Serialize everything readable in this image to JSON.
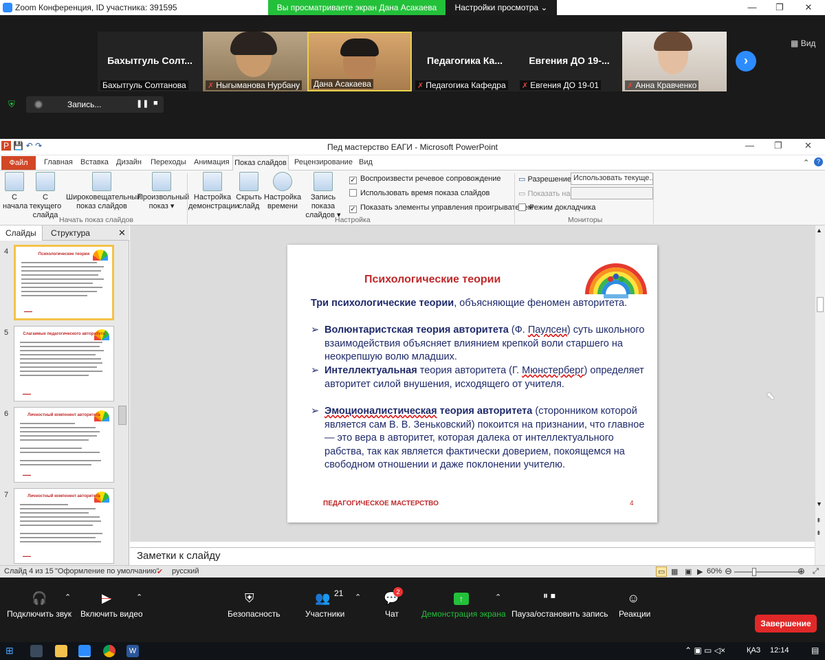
{
  "zoom": {
    "window_title": "Zoom Конференция, ID участника: 391595",
    "view_banner": "Вы просматриваете экран Дана Асакаева",
    "view_options": "Настройки просмотра",
    "view_label": "Вид",
    "recording_label": "Запись...",
    "participants": [
      {
        "big": "Бахытгуль Солт...",
        "name": "Бахытгуль Солтанова",
        "muted": false
      },
      {
        "big": "",
        "name": "Ныгыманова Нурбану",
        "muted": true
      },
      {
        "big": "",
        "name": "Дана Асакаева",
        "muted": false
      },
      {
        "big": "Педагогика Ка...",
        "name": "Педагогика Кафедра",
        "muted": true
      },
      {
        "big": "Евгения ДО 19-...",
        "name": "Евгения ДО 19-01",
        "muted": true
      },
      {
        "big": "",
        "name": "Анна Кравченко",
        "muted": true
      }
    ],
    "toolbar": {
      "audio": "Подключить звук",
      "video": "Включить видео",
      "security": "Безопасность",
      "participants": "Участники",
      "participants_count": "21",
      "chat": "Чат",
      "chat_badge": "2",
      "share": "Демонстрация экрана",
      "record": "Пауза/остановить запись",
      "reactions": "Реакции",
      "end": "Завершение"
    }
  },
  "ppt": {
    "title": "Пед мастерство ЕАГИ  -  Microsoft PowerPoint",
    "tabs": [
      "Файл",
      "Главная",
      "Вставка",
      "Дизайн",
      "Переходы",
      "Анимация",
      "Показ слайдов",
      "Рецензирование",
      "Вид"
    ],
    "ribbon": {
      "group1_label": "Начать показ слайдов",
      "btn_from_start": [
        "С",
        "начала"
      ],
      "btn_from_current": [
        "С текущего",
        "слайда"
      ],
      "btn_broadcast": [
        "Широковещательный",
        "показ слайдов"
      ],
      "btn_custom": [
        "Произвольный",
        "показ"
      ],
      "group2_label": "Настройка",
      "btn_setup": [
        "Настройка",
        "демонстрации"
      ],
      "btn_hide": [
        "Скрыть",
        "слайд"
      ],
      "btn_rehearse": [
        "Настройка",
        "времени"
      ],
      "btn_record": [
        "Запись показа",
        "слайдов"
      ],
      "chk_narration": "Воспроизвести речевое сопровождение",
      "chk_timings": "Использовать время показа слайдов",
      "chk_controls": "Показать элементы управления проигрывателем",
      "group3_label": "Мониторы",
      "resolution_label": "Разрешение:",
      "resolution_value": "Использовать текуще...",
      "show_on_label": "Показать на:",
      "presenter_view": "Режим докладчика"
    },
    "pane_tabs": [
      "Слайды",
      "Структура"
    ],
    "thumbs": [
      {
        "num": "4",
        "title": "Психологические теории"
      },
      {
        "num": "5",
        "title": "Слагаемые педагогического авторитета"
      },
      {
        "num": "6",
        "title": "Личностный компонент авторитета"
      },
      {
        "num": "7",
        "title": "Личностный компонент авторитета"
      }
    ],
    "slide": {
      "title": "Психологические теории",
      "intro_bold": "Три психологические теории",
      "intro_rest": ", объясняющие феномен авторитета.",
      "b1_bold": "Волюнтаристская теория авторитета",
      "b1_a": " (Ф. ",
      "b1_u": "Паулсен",
      "b1_b": ") суть школьного взаимодействия объясняет влиянием крепкой воли старшего на неокрепшую волю младших.",
      "b2_bold": "Интеллектуальная",
      "b2_a": " теория авторитета (Г. ",
      "b2_u": "Мюнстерберг",
      "b2_b": ") определяет авторитет силой внушения, исходящего от учителя.",
      "b3_bold": "Эмоционалистическая",
      "b3_bold2": " теория авторитета",
      "b3_rest": " (сторонником которой является сам В. В. Зеньковский) покоится на признании, что главное — это вера в авторитет, которая далека от интеллектуального рабства, так как является фактически доверием, покоящемся на свободном отношении и даже поклонении учителю.",
      "footer": "ПЕДАГОГИЧЕСКОЕ МАСТЕРСТВО",
      "page": "4"
    },
    "notes": "Заметки к слайду",
    "status": {
      "slide_of": "Слайд 4 из 15",
      "theme": "\"Оформление по умолчанию\"",
      "lang": "русский",
      "zoom": "60%"
    }
  },
  "taskbar": {
    "lang": "ҚАЗ",
    "time": "12:14"
  }
}
